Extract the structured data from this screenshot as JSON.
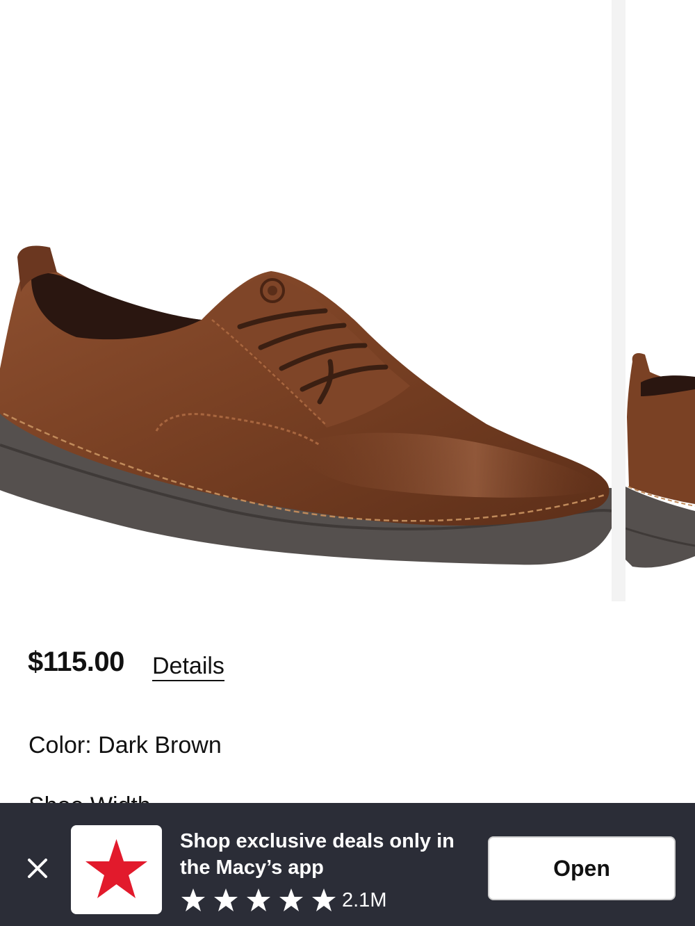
{
  "product": {
    "image_alt": "Dark brown leather lace-up oxford shoe",
    "price": "$115.00",
    "details_label": "Details",
    "color_label": "Color: Dark Brown",
    "next_section_peek": "Shoe Width"
  },
  "app_banner": {
    "close_icon": "close-icon",
    "app_icon": "macys-star-icon",
    "message": "Shop exclusive deals only in the Macy’s app",
    "rating_stars": 5,
    "rating_count": "2.1M",
    "open_label": "Open"
  },
  "colors": {
    "banner_background": "#2b2d37",
    "brand_red": "#e21a2c",
    "shoe_leather": "#7a4124",
    "sole": "#55504e"
  }
}
